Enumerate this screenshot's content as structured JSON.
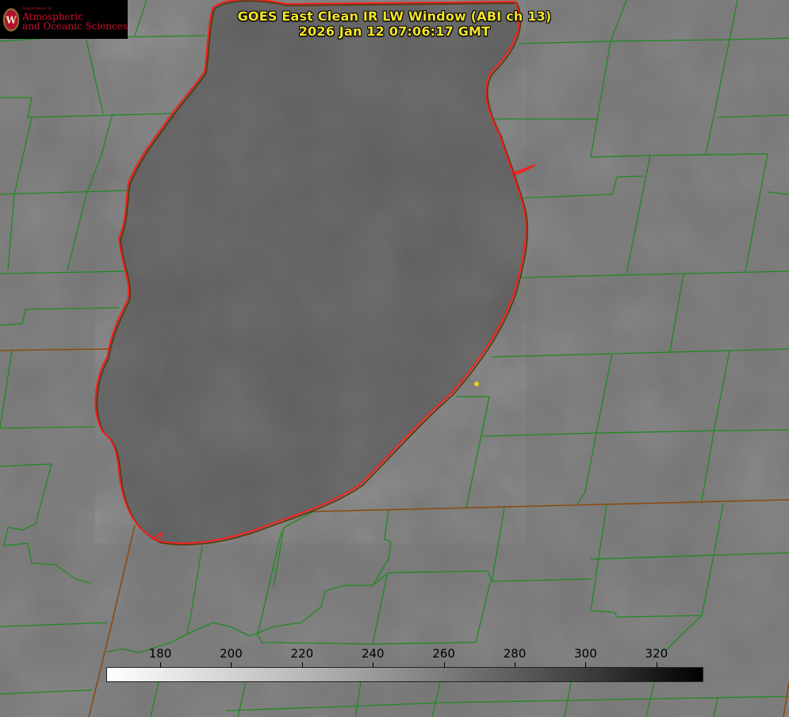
{
  "title": {
    "line1": "GOES East Clean IR LW Window (ABI ch 13)",
    "line2": "2026 Jan 12 07:06:17 GMT"
  },
  "logo": {
    "department": "Department of",
    "line1": "Atmospheric",
    "line2": "and Oceanic Sciences",
    "seal_letter": "W"
  },
  "colorbar": {
    "ticks": [
      180,
      200,
      220,
      240,
      260,
      280,
      300,
      320
    ],
    "min": 165,
    "max": 333,
    "scale": "white (cold) to black (warm)"
  },
  "colors": {
    "title_text": "#f2e32a",
    "county_lines": "#1f8a1f",
    "state_lines": "#8a4a10",
    "lake_coast": "#ff1a1a",
    "city_dot": "#e5d21a",
    "land": "#767676",
    "lake": "#5e5e5e",
    "logo_text": "#c9102f"
  },
  "icons": {
    "logo": "uw-seal-icon",
    "city": "city-dot-icon"
  }
}
